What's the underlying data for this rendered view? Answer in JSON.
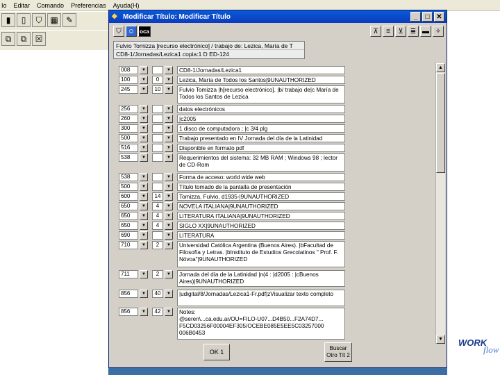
{
  "menubar": {
    "items": [
      "Io",
      "Editar",
      "Comando",
      "Preferencias",
      "Ayuda(H)"
    ]
  },
  "dialog": {
    "title": "Modificar Título: Modificar Título",
    "info_line1": "Fulvio Tomizza [recurso electrónico] / trabajo de: Lezica, María de T",
    "info_line2": "CD8-1/Jornadas/Lezica1    copia:1      D ED-124",
    "ok_label": "OK 1",
    "find_label": "Buscar Otro Tít 2",
    "fields": [
      {
        "tag": "008",
        "ind1": "",
        "ind2": "",
        "value": "CD8-1/Jornadas/Lezica1"
      },
      {
        "tag": "100",
        "ind1": "",
        "ind2": "0",
        "value": "Lezica, María de Todos los Santos|9UNAUTHORIZED"
      },
      {
        "tag": "245",
        "ind1": "",
        "ind2": "10",
        "value": "Fulvio Tomizza |h[recurso electrónico]. |b/ trabajo de|c María de Todos los Santos de Lezica"
      },
      {
        "tag": "256",
        "ind1": "",
        "ind2": "",
        "value": "datos electrónicos"
      },
      {
        "tag": "260",
        "ind1": "",
        "ind2": "",
        "value": "|c2005"
      },
      {
        "tag": "300",
        "ind1": "",
        "ind2": "",
        "value": "1 disco de computadora ; |c 3/4 plg"
      },
      {
        "tag": "500",
        "ind1": "",
        "ind2": "",
        "value": "Trabajo presentado en IV Jornada del día de la Latinidad"
      },
      {
        "tag": "516",
        "ind1": "",
        "ind2": "",
        "value": "Disponible en formato pdf"
      },
      {
        "tag": "538",
        "ind1": "",
        "ind2": "",
        "value": "Requerimientos del sistema: 32 MB RAM ; Windows 98 ; lector de CD-Rom"
      },
      {
        "tag": "538",
        "ind1": "",
        "ind2": "",
        "value": "Forma de acceso: world wide web"
      },
      {
        "tag": "500",
        "ind1": "",
        "ind2": "",
        "value": "Título tomado de la pantalla de presentación"
      },
      {
        "tag": "600",
        "ind1": "",
        "ind2": "14",
        "value": "Tomizza, Fulvio, d1935-|9UNAUTHORIZED"
      },
      {
        "tag": "650",
        "ind1": "",
        "ind2": "4",
        "value": "NOVELA ITALIANA|9UNAUTHORIZED"
      },
      {
        "tag": "650",
        "ind1": "",
        "ind2": "4",
        "value": "LITERATURA ITALIANA|9UNAUTHORIZED"
      },
      {
        "tag": "650",
        "ind1": "",
        "ind2": "4",
        "value": "SIGLO XX|9UNAUTHORIZED"
      },
      {
        "tag": "690",
        "ind1": "",
        "ind2": "",
        "value": "LITERATURA"
      },
      {
        "tag": "710",
        "ind1": "",
        "ind2": "2",
        "value": "Universidad Católica Argentina (Buenos Aires). |bFacultad de Filosofía y Letras. |bInstituto de Estudios Grecolatinos \" Prof. F. Nóvoa\"|9UNAUTHORIZED"
      },
      {
        "tag": "711",
        "ind1": "",
        "ind2": "2",
        "value": "Jornada del día de la Latinidad |n(4 : |d2005 : |cBuenos Aires)|9UNAUTHORIZED"
      },
      {
        "tag": "856",
        "ind1": "",
        "ind2": "40",
        "value": "|udigital/8/Jornadas/Lezica1-Fr.pdf|zVisualizar texto completo"
      },
      {
        "tag": "856",
        "ind1": "",
        "ind2": "42",
        "value": "Notes:\n@seren\\...ca.edu.ar/OU=FILO-U07...D4B50...F2A74D7...\nF5CD03256F00004EF305/OCEBE085E5EE5C03257000\n006B0453"
      }
    ]
  },
  "logo": {
    "part1": "WORK",
    "part2": "flow"
  }
}
